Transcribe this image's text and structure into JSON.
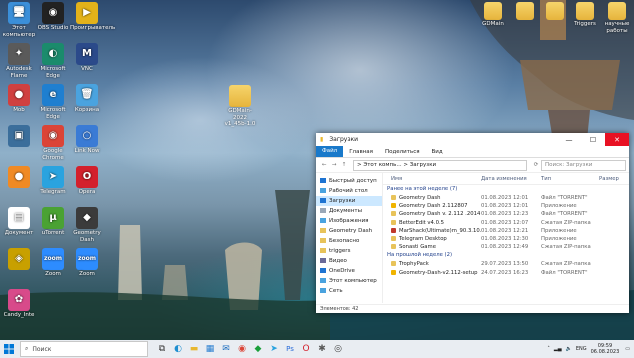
{
  "desktop": {
    "icons_left": [
      {
        "label": "Этот компьютер",
        "glyph": "🖥",
        "color": "#3b8fd9"
      },
      {
        "label": "OBS Studio",
        "glyph": "◉",
        "color": "#222"
      },
      {
        "label": "Проигрыватель",
        "glyph": "▶",
        "color": "#e3b21a"
      },
      {
        "label": "Autodesk Flame",
        "glyph": "✦",
        "color": "#5a5a5a"
      },
      {
        "label": "Microsoft Edge",
        "glyph": "◐",
        "color": "#1b8b6c"
      },
      {
        "label": "VNC",
        "glyph": "M",
        "color": "#2b4a8a"
      },
      {
        "label": "Mob",
        "glyph": "●",
        "color": "#d04040"
      },
      {
        "label": "Microsoft Edge",
        "glyph": "e",
        "color": "#1f7fd0"
      },
      {
        "label": "Корзина",
        "glyph": "🗑",
        "color": "#4aa3df"
      },
      {
        "label": "",
        "glyph": "▣",
        "color": "#3b6e9b"
      },
      {
        "label": "Google Chrome",
        "glyph": "◉",
        "color": "#db4437"
      },
      {
        "label": "Link Now",
        "glyph": "○",
        "color": "#3a7bd5"
      },
      {
        "label": "",
        "glyph": "●",
        "color": "#f08a24"
      },
      {
        "label": "Telegram",
        "glyph": "➤",
        "color": "#2aa3df"
      },
      {
        "label": "Opera",
        "glyph": "O",
        "color": "#d3202c"
      },
      {
        "label": "Документ",
        "glyph": "▤",
        "color": "#ffffff"
      },
      {
        "label": "uTorrent",
        "glyph": "µ",
        "color": "#4aa233"
      },
      {
        "label": "Geometry Dash",
        "glyph": "◆",
        "color": "#3b3b3b"
      },
      {
        "label": "",
        "glyph": "◈",
        "color": "#c8a000"
      },
      {
        "label": "Zoom",
        "glyph": "zoom",
        "color": "#2d8cff"
      },
      {
        "label": "Zoom",
        "glyph": "zoom",
        "color": "#2d8cff"
      },
      {
        "label": "Candy_Inte",
        "glyph": "✿",
        "color": "#d84a8a"
      }
    ],
    "icons_top_right": [
      {
        "label": "GDMain",
        "glyph": "",
        "color": "folder"
      },
      {
        "label": "",
        "glyph": "",
        "color": "folder"
      },
      {
        "label": "",
        "glyph": "",
        "color": "folder"
      },
      {
        "label": "Triggers",
        "glyph": "",
        "color": "folder"
      },
      {
        "label": "научные работы",
        "glyph": "",
        "color": "folder"
      }
    ],
    "middle_folder_label": "GDMain-2022",
    "middle_folder_sub": "v1_45b-1.0"
  },
  "explorer": {
    "title": "Загрузки",
    "ribbon_tabs": [
      "Файл",
      "Главная",
      "Поделиться",
      "Вид"
    ],
    "path": "> Этот компь... > Загрузки",
    "search_placeholder": "Поиск: Загрузки",
    "nav_items": [
      {
        "label": "Быстрый доступ",
        "color": "#1e74d2",
        "selected": false
      },
      {
        "label": "Рабочий стол",
        "color": "#4aa3df",
        "selected": false
      },
      {
        "label": "Загрузки",
        "color": "#1e74d2",
        "selected": true
      },
      {
        "label": "Документы",
        "color": "#9aa8b8",
        "selected": false
      },
      {
        "label": "Изображения",
        "color": "#4aa3df",
        "selected": false
      },
      {
        "label": "Geometry Dash",
        "color": "#e8c35a",
        "selected": false
      },
      {
        "label": "Безопасно",
        "color": "#e8c35a",
        "selected": false
      },
      {
        "label": "triggers",
        "color": "#e8c35a",
        "selected": false
      },
      {
        "label": "Видео",
        "color": "#6a6a9a",
        "selected": false
      },
      {
        "label": "OneDrive",
        "color": "#1e74d2",
        "selected": false
      },
      {
        "label": "Этот компьютер",
        "color": "#4aa3df",
        "selected": false
      },
      {
        "label": "Сеть",
        "color": "#4aa3df",
        "selected": false
      }
    ],
    "columns": [
      "Имя",
      "Дата изменения",
      "Тип",
      "Размер"
    ],
    "groups": [
      {
        "title": "Ранее на этой неделе (7)",
        "files": [
          {
            "name": "Geometry Dash",
            "date": "01.08.2023 12:01",
            "type": "Файл \"TORRENT\"",
            "size": "",
            "color": "#e8c35a"
          },
          {
            "name": "Geometry Dash 2.112807",
            "date": "01.08.2023 12:01",
            "type": "Приложение",
            "size": "",
            "color": "#f0b400"
          },
          {
            "name": "Geometry Dash v. 2.112 .2014",
            "date": "01.08.2023 12:23",
            "type": "Файл \"TORRENT\"",
            "size": "",
            "color": "#e8c35a"
          },
          {
            "name": "BetterEdit v4.0.5",
            "date": "01.08.2023 12:07",
            "type": "Сжатая ZIP-папка",
            "size": "",
            "color": "#e8c35a"
          },
          {
            "name": "MarShack(Ultimate)m_90.3.10.1004_subw...",
            "date": "01.08.2023 12:21",
            "type": "Приложение",
            "size": "",
            "color": "#c0392b"
          },
          {
            "name": "Telegram Desktop",
            "date": "01.08.2023 12:30",
            "type": "Приложение",
            "size": "",
            "color": "#e8c35a"
          },
          {
            "name": "Sonasti Game",
            "date": "01.08.2023 12:49",
            "type": "Сжатая ZIP-папка",
            "size": "",
            "color": "#e8c35a"
          }
        ]
      },
      {
        "title": "На прошлой неделе (2)",
        "files": [
          {
            "name": "TrophyPack",
            "date": "29.07.2023 13:50",
            "type": "Сжатая ZIP-папка",
            "size": "",
            "color": "#e8c35a"
          },
          {
            "name": "Geometry-Dash-v2.112-setup",
            "date": "24.07.2023 16:23",
            "type": "Файл \"TORRENT\"",
            "size": "",
            "color": "#f0b400"
          }
        ]
      }
    ],
    "status_text": "Элементов: 42"
  },
  "taskbar": {
    "search_placeholder": "Поиск",
    "apps": [
      {
        "name": "task-view",
        "glyph": "⧉",
        "color": "#333"
      },
      {
        "name": "edge",
        "glyph": "◐",
        "color": "#1f8fd0"
      },
      {
        "name": "file-explorer",
        "glyph": "▬",
        "color": "#e8b830"
      },
      {
        "name": "store",
        "glyph": "▦",
        "color": "#2a7fd0"
      },
      {
        "name": "mail",
        "glyph": "✉",
        "color": "#1f6fc0"
      },
      {
        "name": "chrome",
        "glyph": "◉",
        "color": "#db4437"
      },
      {
        "name": "geometry-dash",
        "glyph": "◆",
        "color": "#1a9f3a"
      },
      {
        "name": "telegram",
        "glyph": "➤",
        "color": "#2aa3df"
      },
      {
        "name": "photoshop",
        "glyph": "Ps",
        "color": "#2a6cd9"
      },
      {
        "name": "opera",
        "glyph": "O",
        "color": "#d3202c"
      },
      {
        "name": "app-x",
        "glyph": "✱",
        "color": "#5a5a5a"
      },
      {
        "name": "app-y",
        "glyph": "◎",
        "color": "#444"
      }
    ],
    "language": "ENG",
    "time": "09:59",
    "date": "06.08.2023"
  }
}
